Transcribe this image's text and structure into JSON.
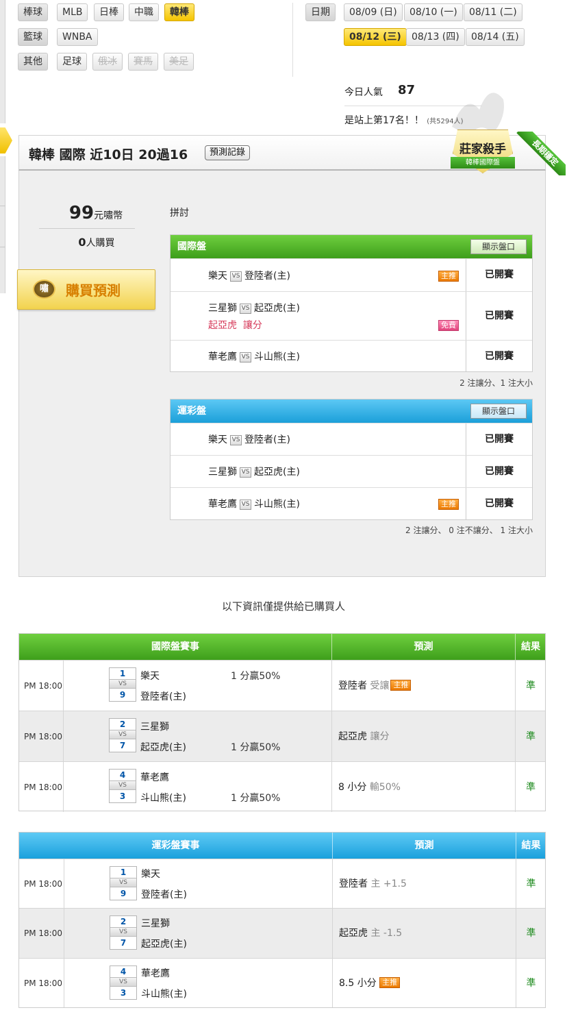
{
  "categories": [
    {
      "label": "棒球",
      "items": [
        {
          "label": "MLB"
        },
        {
          "label": "日棒"
        },
        {
          "label": "中職"
        },
        {
          "label": "韓棒",
          "active": true
        }
      ]
    },
    {
      "label": "籃球",
      "items": [
        {
          "label": "WNBA"
        }
      ]
    },
    {
      "label": "其他",
      "items": [
        {
          "label": "足球"
        },
        {
          "label": "俄冰",
          "disabled": true
        },
        {
          "label": "賽馬",
          "disabled": true
        },
        {
          "label": "美足",
          "disabled": true
        }
      ]
    }
  ],
  "dates": {
    "label": "日期",
    "items": [
      "08/09 (日)",
      "08/10 (一)",
      "08/11 (二)",
      "08/12 (三)",
      "08/13 (四)",
      "08/14 (五)"
    ],
    "active": "08/12 (三)"
  },
  "popularity": {
    "label": "今日人氣",
    "value": "87",
    "rank_text": "是站上第17名！！",
    "total_text": "(共5294人)"
  },
  "badge": {
    "title": "莊家殺手",
    "subtitle": "韓棒國際盤",
    "ribbon": "長期穩定"
  },
  "header": {
    "title": "韓棒 國際 近10日 20過16",
    "record_button": "預測記錄"
  },
  "price": {
    "amount": "99",
    "unit": "元嘯幣",
    "buyers_count": "0",
    "buyers_label": "人購買",
    "buy_button": "購買預測",
    "logo_char": "嘯"
  },
  "matchup_label": "拼討",
  "intl": {
    "title": "國際盤",
    "show_button": "顯示盤口",
    "rows": [
      {
        "away": "樂天",
        "home": "登陸者(主)",
        "tag": "主推",
        "status": "已開賽"
      },
      {
        "away": "三星獅",
        "home": "起亞虎(主)",
        "pick_team": "起亞虎",
        "pick_type": "讓分",
        "tag": "免費",
        "status": "已開賽"
      },
      {
        "away": "華老鷹",
        "home": "斗山熊(主)",
        "status": "已開賽"
      }
    ],
    "summary": "2 注讓分、1 注大小"
  },
  "lottery": {
    "title": "運彩盤",
    "show_button": "顯示盤口",
    "rows": [
      {
        "away": "樂天",
        "home": "登陸者(主)",
        "status": "已開賽"
      },
      {
        "away": "三星獅",
        "home": "起亞虎(主)",
        "status": "已開賽"
      },
      {
        "away": "華老鷹",
        "home": "斗山熊(主)",
        "tag": "主推",
        "status": "已開賽"
      }
    ],
    "summary": "2 注讓分、 0 注不讓分、 1 注大小"
  },
  "notice": "以下資訊僅提供給已購買人",
  "intl_results": {
    "headers": [
      "國際盤賽事",
      "預測",
      "結果"
    ],
    "vs": "VS",
    "rows": [
      {
        "time": "PM 18:00",
        "n1": "1",
        "n2": "9",
        "team1": "樂天",
        "team2": "登陸者(主)",
        "note1": "1 分贏50%",
        "note2": "",
        "pick": "登陸者",
        "pick_sub": "受讓",
        "tag": "主推",
        "result": "準"
      },
      {
        "time": "PM 18:00",
        "n1": "2",
        "n2": "7",
        "team1": "三星獅",
        "team2": "起亞虎(主)",
        "note1": "",
        "note2": "1 分贏50%",
        "pick": "起亞虎",
        "pick_sub": "讓分",
        "result": "準"
      },
      {
        "time": "PM 18:00",
        "n1": "4",
        "n2": "3",
        "team1": "華老鷹",
        "team2": "斗山熊(主)",
        "note1": "",
        "note2": "1 分贏50%",
        "pick": "8 小分",
        "pick_sub": "輸50%",
        "result": "準"
      }
    ]
  },
  "lottery_results": {
    "headers": [
      "運彩盤賽事",
      "預測",
      "結果"
    ],
    "vs": "VS",
    "rows": [
      {
        "time": "PM 18:00",
        "n1": "1",
        "n2": "9",
        "team1": "樂天",
        "team2": "登陸者(主)",
        "pick": "登陸者",
        "pick_sub": "主 +1.5",
        "result": "準"
      },
      {
        "time": "PM 18:00",
        "n1": "2",
        "n2": "7",
        "team1": "三星獅",
        "team2": "起亞虎(主)",
        "pick": "起亞虎",
        "pick_sub": "主 -1.5",
        "result": "準"
      },
      {
        "time": "PM 18:00",
        "n1": "4",
        "n2": "3",
        "team1": "華老鷹",
        "team2": "斗山熊(主)",
        "pick": "8.5 小分",
        "pick_sub": "",
        "tag": "主推",
        "result": "準"
      }
    ]
  }
}
